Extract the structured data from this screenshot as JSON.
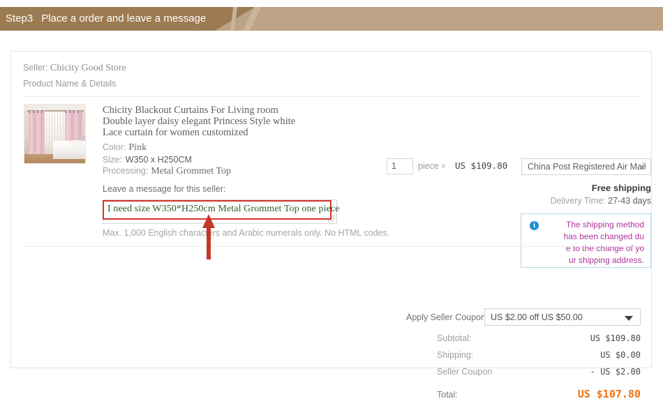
{
  "banner": {
    "step": "Step3",
    "title": "Place a order and leave a message"
  },
  "card": {
    "seller_label": "Seller:",
    "seller_name": "Chicity Good Store",
    "product_name_details": "Product Name & Details"
  },
  "product": {
    "thumbnail_alt": "pink-curtain-bedroom-photo",
    "title": "Chicity Blackout Curtains For Living room Double layer daisy elegant Princess Style white Lace curtain for women customized",
    "attributes": [
      {
        "label": "Color:",
        "value": "Pink",
        "serif": true
      },
      {
        "label": "Size:",
        "value": "W350 x H250CM",
        "serif": false
      },
      {
        "label": "Processing:",
        "value": "Metal Grommet Top",
        "serif": true
      }
    ],
    "message_label": "Leave a message for this seller:",
    "message_value": "I need size W350*H250cm Metal Grommet Top one piece",
    "message_hint": "Max. 1,000 English characters and Arabic numerals only. No HTML codes.",
    "highlight_color": "#d0342c",
    "message_text_color": "#2f5d32"
  },
  "quantity": {
    "value": "1",
    "unit": "piece",
    "times": "×",
    "price": "US $109.80"
  },
  "shipping": {
    "method": "China Post Registered Air Mail",
    "free_shipping": "Free shipping",
    "delivery_label": "Delivery Time:",
    "delivery_days": "27-43 days",
    "notice_icon": "info-icon",
    "notice_lines": [
      "The shipping method",
      "has been changed du",
      "e to the change of yo",
      "ur shipping address."
    ],
    "notice_color": "#b0349a",
    "notice_border_color": "#b5d8ea"
  },
  "coupon": {
    "label": "Apply Seller Coupon:",
    "selected": "US $2.00 off US $50.00"
  },
  "totals": {
    "rows": [
      {
        "label": "Subtotal:",
        "value": "US $109.80"
      },
      {
        "label": "Shipping:",
        "value": "US $0.00"
      },
      {
        "label": "Seller Coupon",
        "value": "- US $2.00"
      }
    ],
    "grand": {
      "label": "Total:",
      "value": "US $107.80",
      "color": "#f2700f"
    }
  }
}
